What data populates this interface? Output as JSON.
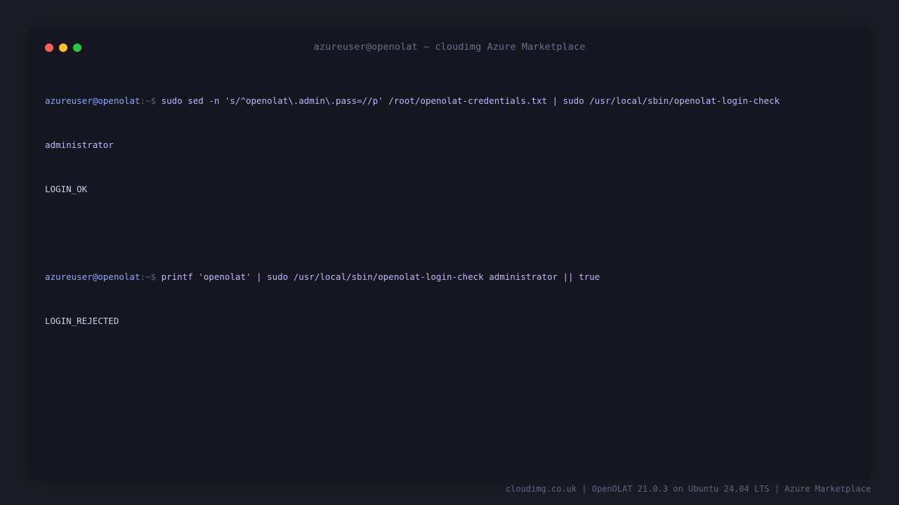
{
  "window": {
    "title": "azureuser@openolat ~ cloudimg Azure Marketplace",
    "controls": {
      "close_color": "#ff5f57",
      "minimize_color": "#febc2e",
      "maximize_color": "#28c840"
    }
  },
  "terminal": {
    "entries": [
      {
        "prompt_user": "azureuser@openolat",
        "prompt_path": ":~$",
        "command": "sudo sed -n 's/^openolat\\.admin\\.pass=//p' /root/openolat-credentials.txt | sudo /usr/local/sbin/openolat-login-check",
        "command_wrap": "administrator",
        "output": "LOGIN_OK"
      },
      {
        "prompt_user": "azureuser@openolat",
        "prompt_path": ":~$",
        "command": "printf 'openolat' | sudo /usr/local/sbin/openolat-login-check administrator || true",
        "output": "LOGIN_REJECTED"
      }
    ]
  },
  "footer": {
    "text": "cloudimg.co.uk | OpenOLAT 21.0.3 on Ubuntu 24.04 LTS | Azure Marketplace"
  }
}
